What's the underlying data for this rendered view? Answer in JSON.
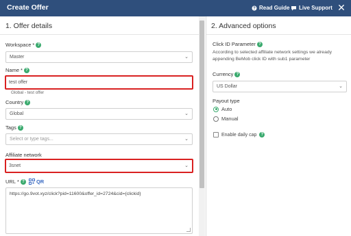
{
  "header": {
    "title": "Create Offer",
    "read_guide": "Read Guide",
    "live_support": "Live Support",
    "close": "✕"
  },
  "offer_details": {
    "title": "1. Offer details",
    "workspace": {
      "label": "Workspace",
      "req": "*",
      "help": "?",
      "value": "Master"
    },
    "name": {
      "label": "Name",
      "req": "*",
      "help": "?",
      "value": "test offer",
      "hint": "Global - test offer"
    },
    "country": {
      "label": "Country",
      "help": "?",
      "value": "Global"
    },
    "tags": {
      "label": "Tags",
      "help": "?",
      "placeholder": "Select or type tags..."
    },
    "affiliate_network": {
      "label": "Affiliate network",
      "value": "3snet"
    },
    "url": {
      "label": "URL",
      "req": "*",
      "help": "?",
      "qr_label": "QR",
      "value": "https://go.9vot.xyz/click?pid=11600&offer_id=2724&cid={clickid}"
    }
  },
  "advanced_options": {
    "title": "2. Advanced options",
    "click_id": {
      "label": "Click ID Parameter",
      "help": "?",
      "description": "According to selected affiliate network settings we already appending BeMob click ID with sub1 parameter"
    },
    "currency": {
      "label": "Currency",
      "help": "?",
      "value": "US Dollar"
    },
    "payout_type": {
      "label": "Payout type",
      "options": [
        "Auto",
        "Manual"
      ],
      "selected": "Auto"
    },
    "daily_cap": {
      "label": "Enable daily cap",
      "help": "?",
      "checked": false
    }
  },
  "colors": {
    "header": "#2f4f7c",
    "accent": "#3aaa6e",
    "highlight": "#d92020"
  }
}
